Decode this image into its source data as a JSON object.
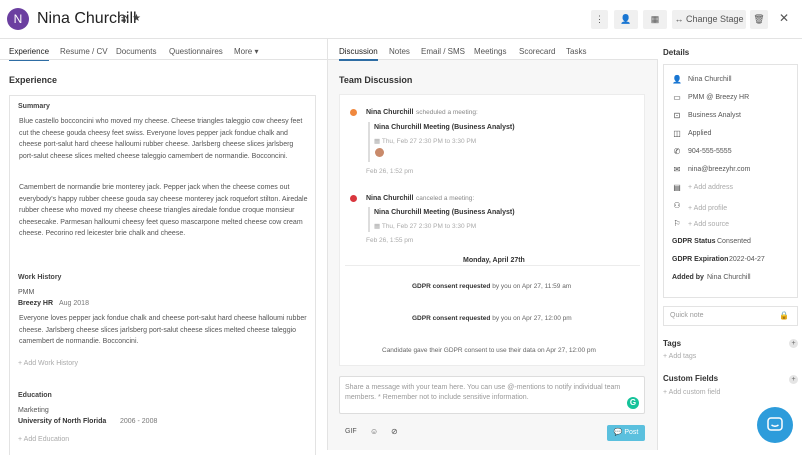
{
  "candidate": {
    "initial": "N",
    "name": "Nina Churchill"
  },
  "header": {
    "change_stage": "Change Stage"
  },
  "left": {
    "tabs": [
      "Experience",
      "Resume / CV",
      "Documents",
      "Questionnaires",
      "More ▾"
    ],
    "title": "Experience",
    "summary_label": "Summary",
    "summary_p1": "Blue castello bocconcini who moved my cheese. Cheese triangles taleggio cow cheesy feet cut the cheese gouda cheesy feet swiss. Everyone loves pepper jack fondue chalk and cheese port-salut hard cheese halloumi rubber cheese. Jarlsberg cheese slices jarlsberg port-salut cheese slices melted cheese taleggio camembert de normandie. Bocconcini.",
    "summary_p2": "Camembert de normandie brie monterey jack. Pepper jack when the cheese comes out everybody's happy rubber cheese gouda say cheese monterey jack roquefort stilton. Airedale rubber cheese who moved my cheese cheese triangles airedale fondue croque monsieur cheesecake. Parmesan halloumi cheesy feet queso mascarpone melted cheese cow cream cheese. Pecorino red leicester brie chalk and cheese.",
    "work_label": "Work History",
    "work_title": "PMM",
    "work_company": "Breezy HR",
    "work_date": "Aug 2018",
    "work_desc": "Everyone loves pepper jack fondue chalk and cheese port-salut hard cheese halloumi rubber cheese. Jarlsberg cheese slices jarlsberg port-salut cheese slices melted cheese taleggio camembert de normandie. Bocconcini.",
    "add_work": "+ Add Work History",
    "edu_label": "Education",
    "edu_field": "Marketing",
    "edu_school": "University of North Florida",
    "edu_years": "2006 - 2008",
    "add_edu": "+ Add Education"
  },
  "mid": {
    "tabs": [
      "Discussion",
      "Notes",
      "Email / SMS",
      "Meetings",
      "Scorecard",
      "Tasks"
    ],
    "title": "Team Discussion",
    "msg1": {
      "author": "Nina Churchill",
      "action": "scheduled a meeting:",
      "meeting": "Nina Churchill Meeting (Business Analyst)",
      "time": "Thu, Feb 27 2:30 PM to 3:30 PM",
      "posted": "Feb 26, 1:52 pm",
      "color": "#f0883e"
    },
    "msg2": {
      "author": "Nina Churchill",
      "action": "canceled a meeting:",
      "meeting": "Nina Churchill Meeting (Business Analyst)",
      "time": "Thu, Feb 27 2:30 PM to 3:30 PM",
      "posted": "Feb 26, 1:55 pm",
      "color": "#d9363e"
    },
    "date_divider": "Monday, April 27th",
    "gdpr1": {
      "bold": "GDPR consent requested",
      "rest": "by you on Apr 27, 11:59 am"
    },
    "gdpr2": {
      "bold": "GDPR consent requested",
      "rest": "by you on Apr 27, 12:00 pm"
    },
    "gdpr3": {
      "text": "Candidate gave their GDPR consent to use their data",
      "rest": "on Apr 27, 12:00 pm"
    },
    "composer_placeholder": "Share a message with your team here. You can use @-mentions to notify individual team members. * Remember not to include sensitive information.",
    "gif": "GIF",
    "post": "Post"
  },
  "right": {
    "title": "Details",
    "name": "Nina Churchill",
    "position": "PMM @ Breezy HR",
    "department": "Business Analyst",
    "stage": "Applied",
    "phone": "904-555-5555",
    "email": "nina@breezyhr.com",
    "add_address": "+ Add address",
    "add_profile": "+ Add profile",
    "add_source": "+ Add source",
    "gdpr_status_label": "GDPR Status",
    "gdpr_status": "Consented",
    "gdpr_exp_label": "GDPR Expiration",
    "gdpr_exp": "2022-04-27",
    "added_by_label": "Added by",
    "added_by": "Nina Churchill",
    "quick_note": "Quick note",
    "tags_label": "Tags",
    "add_tags": "+ Add tags",
    "custom_label": "Custom Fields",
    "add_custom": "+ Add custom field"
  },
  "colors": {
    "accent": "#2e6da4",
    "avatar": "#6b3fa0",
    "post": "#5bc0de",
    "chat": "#2d9cdb",
    "grammarly": "#15c39a"
  }
}
